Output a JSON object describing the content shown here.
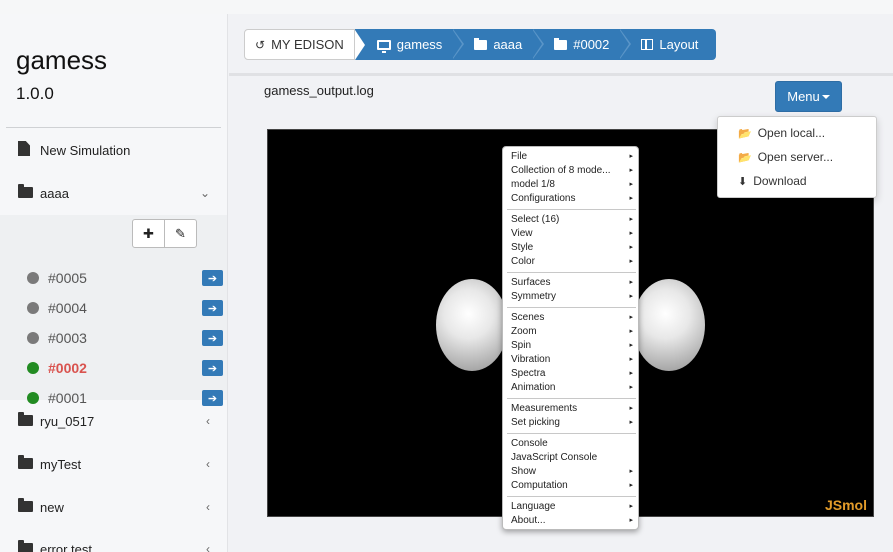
{
  "sidebar": {
    "app_title": "gamess",
    "app_version": "1.0.0",
    "new_simulation": "New Simulation",
    "folders_top": [
      {
        "label": "aaaa"
      }
    ],
    "jobs": [
      {
        "label": "#0005",
        "status_color": "#7a7a7a",
        "active": false
      },
      {
        "label": "#0004",
        "status_color": "#7a7a7a",
        "active": false
      },
      {
        "label": "#0003",
        "status_color": "#7a7a7a",
        "active": false
      },
      {
        "label": "#0002",
        "status_color": "#228b22",
        "active": true
      },
      {
        "label": "#0001",
        "status_color": "#228b22",
        "active": false
      }
    ],
    "folders_bottom": [
      {
        "label": "ryu_0517"
      },
      {
        "label": "myTest"
      },
      {
        "label": "new"
      },
      {
        "label": "error test"
      }
    ]
  },
  "breadcrumb": {
    "home": "MY EDISON",
    "app": "gamess",
    "folder": "aaaa",
    "job": "#0002",
    "layout": "Layout"
  },
  "main": {
    "filename": "gamess_output.log",
    "menu_label": "Menu",
    "dropdown": [
      "Open local...",
      "Open server...",
      "Download"
    ]
  },
  "viewer": {
    "watermark": "JSmol",
    "context_menu": [
      {
        "label": "File",
        "sub": true
      },
      {
        "label": "Collection of 8 mode...",
        "sub": true
      },
      {
        "label": "model 1/8",
        "sub": true
      },
      {
        "label": "Configurations",
        "sub": true
      },
      {
        "sep": true
      },
      {
        "label": "Select (16)",
        "sub": true
      },
      {
        "label": "View",
        "sub": true
      },
      {
        "label": "Style",
        "sub": true
      },
      {
        "label": "Color",
        "sub": true
      },
      {
        "sep": true
      },
      {
        "label": "Surfaces",
        "sub": true
      },
      {
        "label": "Symmetry",
        "sub": true
      },
      {
        "sep": true
      },
      {
        "label": "Scenes",
        "sub": true
      },
      {
        "label": "Zoom",
        "sub": true
      },
      {
        "label": "Spin",
        "sub": true
      },
      {
        "label": "Vibration",
        "sub": true
      },
      {
        "label": "Spectra",
        "sub": true
      },
      {
        "label": "Animation",
        "sub": true
      },
      {
        "sep": true
      },
      {
        "label": "Measurements",
        "sub": true
      },
      {
        "label": "Set picking",
        "sub": true
      },
      {
        "sep": true
      },
      {
        "label": "Console",
        "sub": false
      },
      {
        "label": "JavaScript Console",
        "sub": false
      },
      {
        "label": "Show",
        "sub": true
      },
      {
        "label": "Computation",
        "sub": true
      },
      {
        "sep": true
      },
      {
        "label": "Language",
        "sub": true
      },
      {
        "label": "About...",
        "sub": true
      }
    ]
  }
}
